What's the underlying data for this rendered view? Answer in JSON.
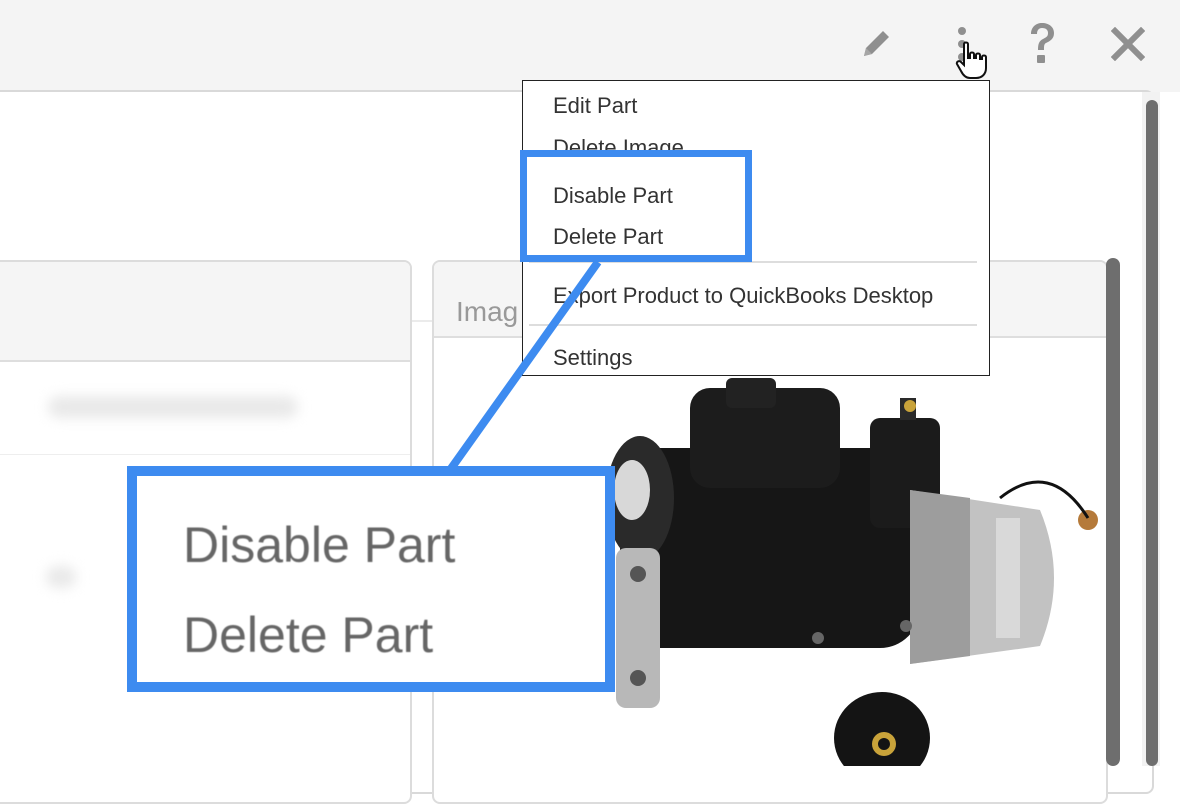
{
  "toolbar": {
    "icons": [
      "pencil-icon",
      "more-vertical-icon",
      "help-icon",
      "close-icon"
    ]
  },
  "images_panel": {
    "header_label": "Imag"
  },
  "menu": {
    "items": [
      "Edit Part",
      "Delete Image",
      "Disable Part",
      "Delete Part",
      "Export Product to QuickBooks Desktop",
      "Settings"
    ]
  },
  "callout": {
    "items": [
      "Disable Part",
      "Delete Part"
    ]
  },
  "colors": {
    "highlight": "#3d8bf0",
    "icon": "#8f8f8f",
    "scroll_thumb": "#6e6e6e"
  }
}
